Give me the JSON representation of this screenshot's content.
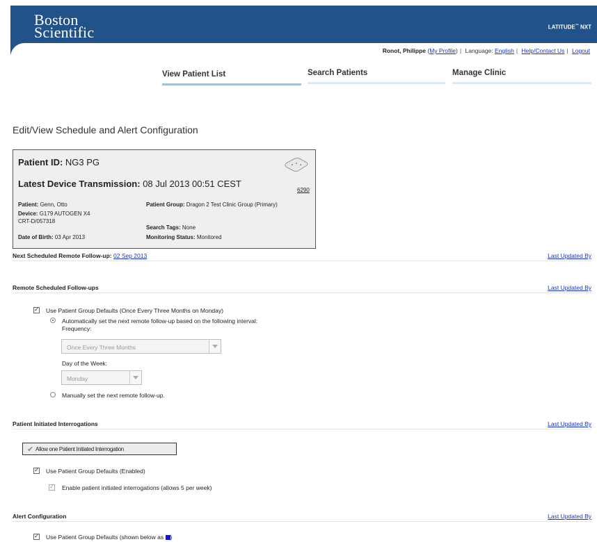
{
  "header": {
    "logo_line1": "Boston",
    "logo_line2": "Scientific",
    "product": "LATITUDE",
    "product_tm": "™",
    "product_suffix": " NXT",
    "user_name": "Ronot, Philippe",
    "my_profile": "My Profile",
    "language_label": "Language:",
    "language_value": "English",
    "help_link": "Help/Contact Us",
    "logout_link": "Logout"
  },
  "nav": [
    {
      "label": "View Patient List"
    },
    {
      "label": "Search Patients"
    },
    {
      "label": "Manage Clinic"
    }
  ],
  "page_title": "Edit/View Schedule and Alert Configuration",
  "patient": {
    "id_label": "Patient ID:",
    "id_value": "NG3 PG",
    "transmission_label": "Latest Device Transmission:",
    "transmission_value": "08 Jul 2013 00:51 CEST",
    "model_number": "6290",
    "patient_label": "Patient:",
    "patient_value": "Genn, Otto",
    "device_label": "Device:",
    "device_value": "G179 AUTOGEN X4 CRT-D/057318",
    "dob_label": "Date of Birth:",
    "dob_value": "03 Apr 2013",
    "group_label": "Patient Group:",
    "group_value": "Dragon 2 Test Clinic Group (Primary)",
    "tags_label": "Search Tags:",
    "tags_value": "None",
    "monitoring_label": "Monitoring Status:",
    "monitoring_value": "Monitored"
  },
  "next_followup": {
    "label": "Next Scheduled Remote Follow-up:",
    "date": "02 Sep 2013",
    "last_updated": "Last Updated By"
  },
  "remote_followups": {
    "title": "Remote Scheduled Follow-ups",
    "last_updated": "Last Updated By",
    "use_defaults": "Use Patient Group Defaults (Once Every Three Months on Monday)",
    "auto_option": "Automatically set the next remote follow-up based on the following interval:",
    "frequency_label": "Frequency:",
    "frequency_value": "Once Every Three Months",
    "day_label": "Day of the Week:",
    "day_value": "Monday",
    "manual_option": "Manually set the next remote follow-up."
  },
  "pii": {
    "title": "Patient Initiated Interrogations",
    "last_updated": "Last Updated By",
    "allow_button": "Allow one Patient Initiated Interrogation",
    "use_defaults": "Use Patient Group Defaults (Enabled)",
    "enable_option": "Enable patient initiated interrogations (allows 5 per week)"
  },
  "alerts": {
    "title": "Alert Configuration",
    "last_updated": "Last Updated By",
    "use_defaults": "Use Patient Group Defaults (shown below as",
    "use_defaults_end": ")",
    "swatch_color": "#1515c8"
  }
}
